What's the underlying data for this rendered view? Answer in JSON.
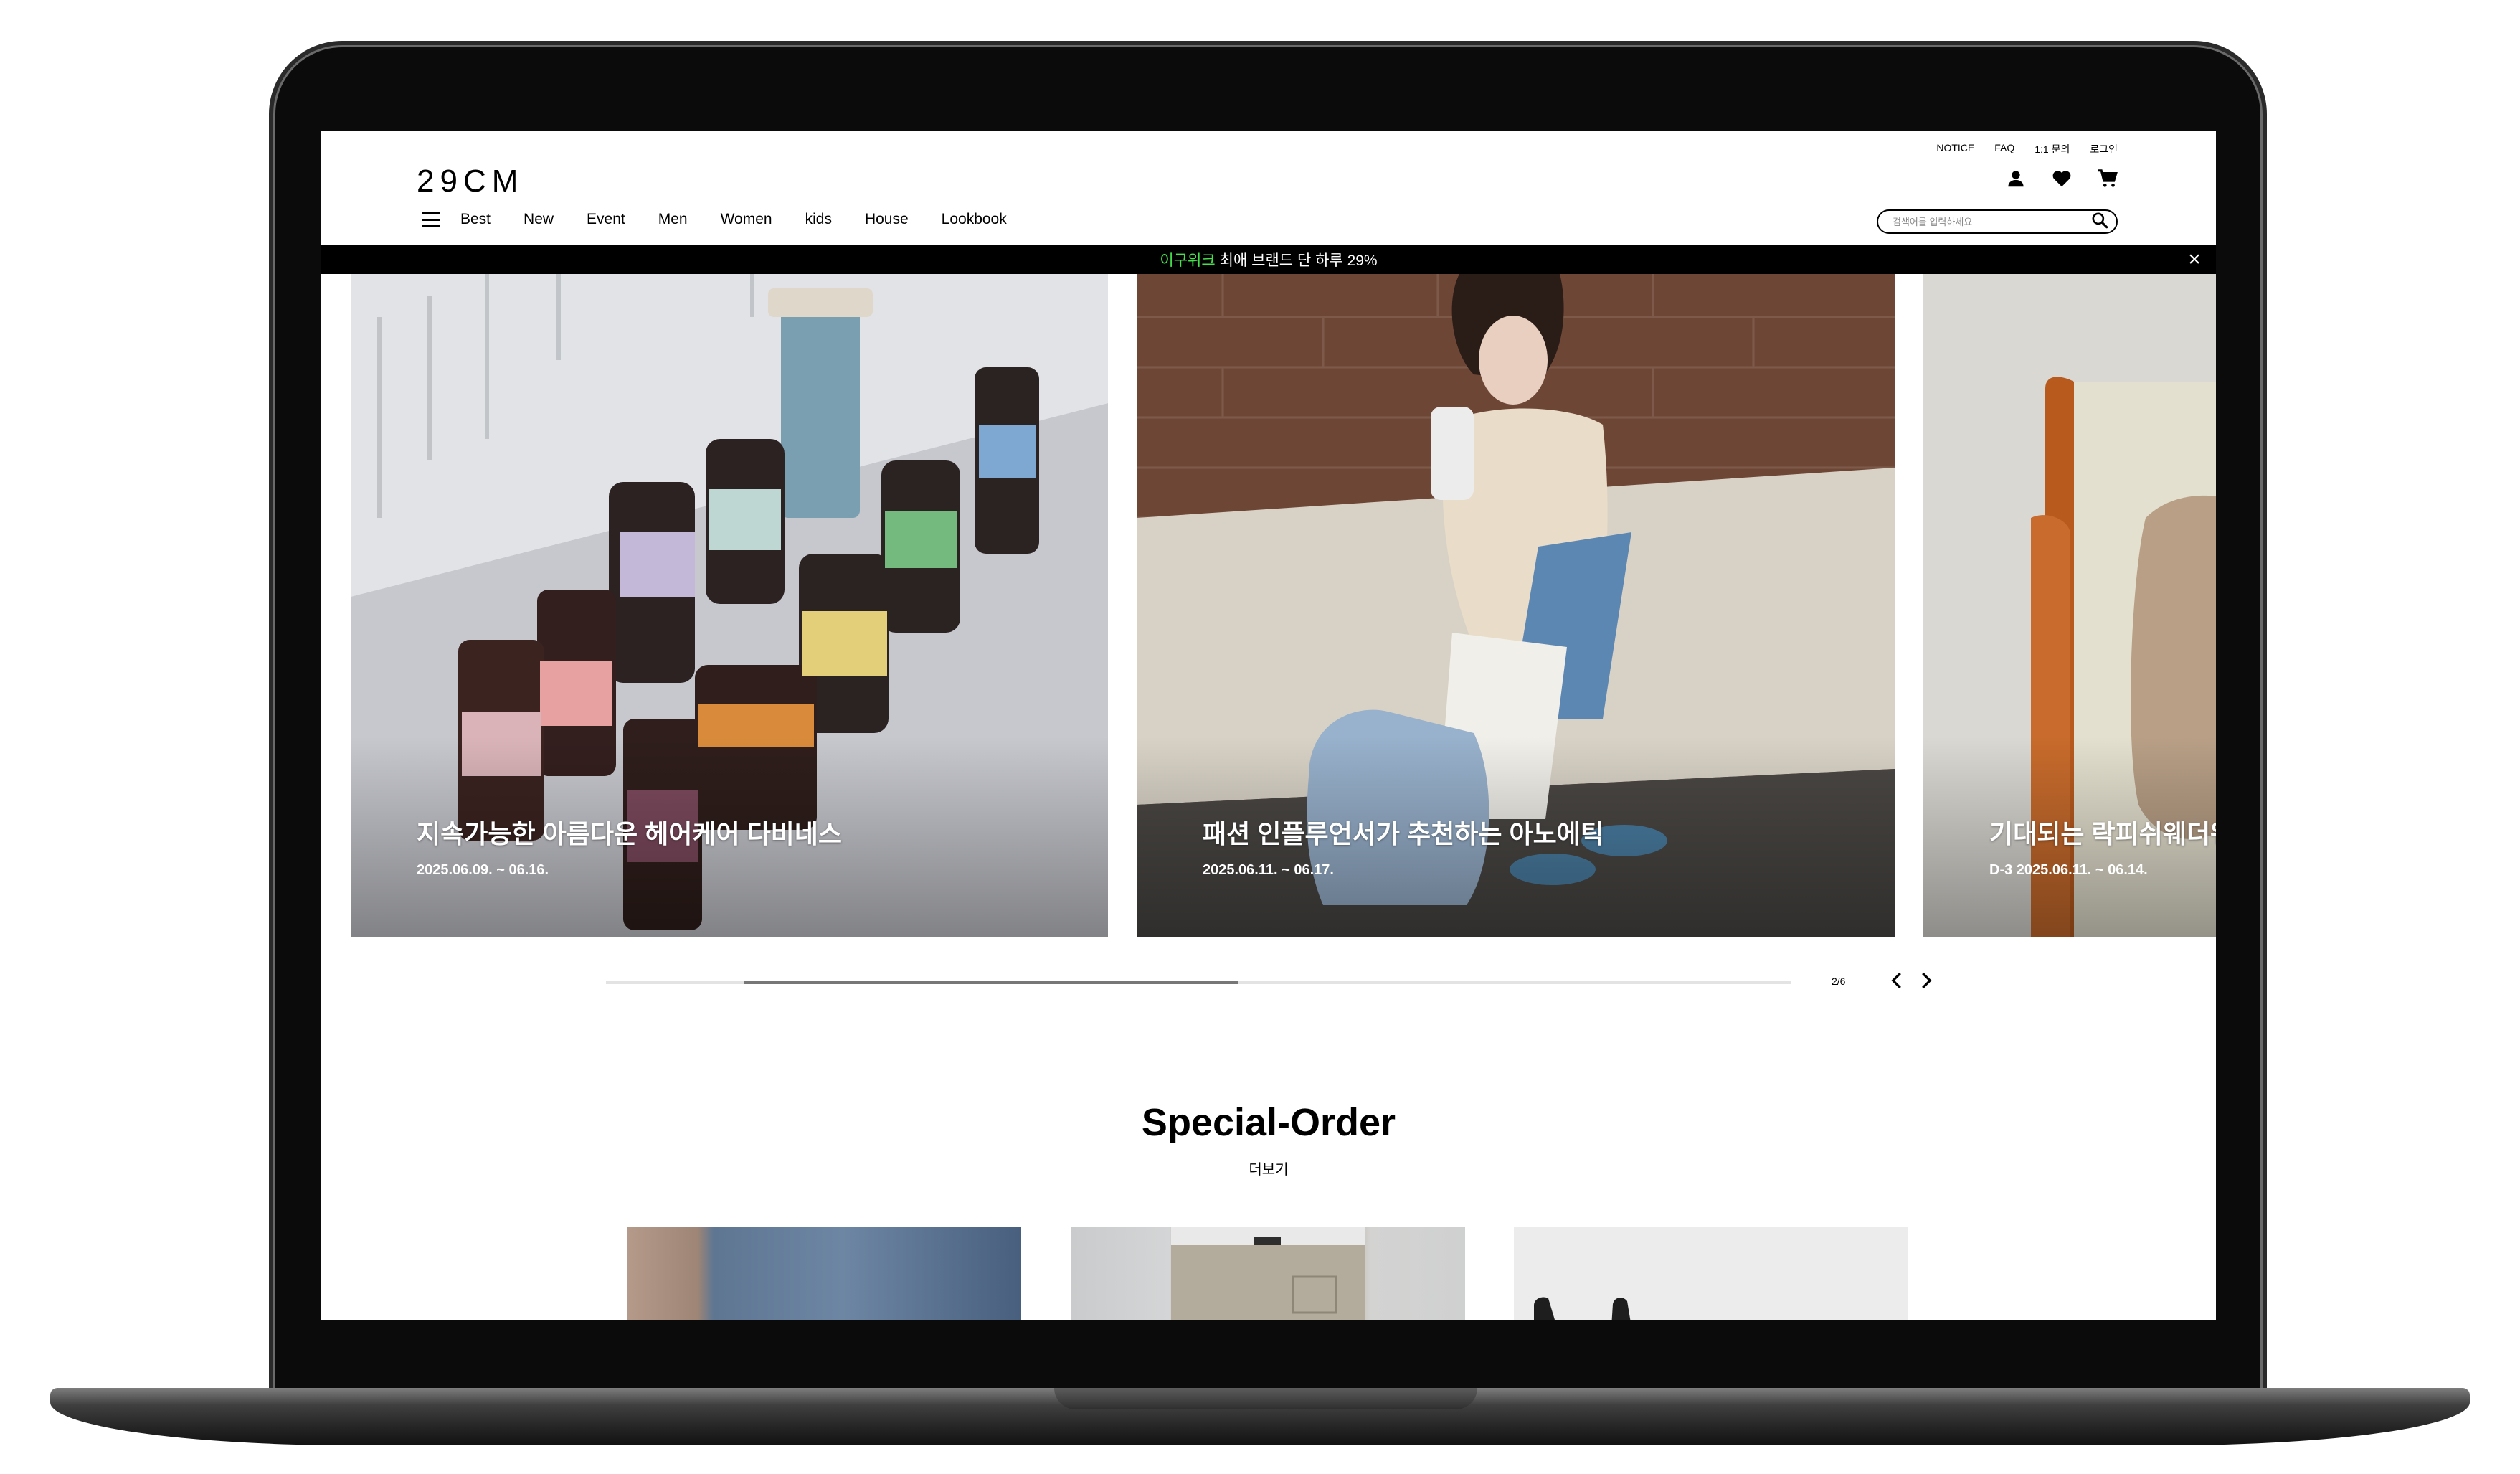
{
  "header": {
    "logo": "29CM",
    "util_links": [
      "NOTICE",
      "FAQ",
      "1:1 문의",
      "로그인"
    ],
    "icons": [
      "user-icon",
      "heart-icon",
      "cart-icon"
    ],
    "nav": [
      "Best",
      "New",
      "Event",
      "Men",
      "Women",
      "kids",
      "House",
      "Lookbook"
    ],
    "search_placeholder": "검색어를 입력하세요"
  },
  "announcement": {
    "highlight": "이구위크",
    "text": "최애 브랜드 단 하루 29%"
  },
  "carousel": {
    "slides": [
      {
        "title": "지속가능한 아름다운 헤어케어 다비네스",
        "date": "2025.06.09. ~ 06.16."
      },
      {
        "title": "패션 인플루언서가 추천하는 아노에틱",
        "date": "2025.06.11. ~ 06.17."
      },
      {
        "title": "기대되는 락피쉬웨더웨",
        "date": "D-3    2025.06.11. ~ 06.14."
      }
    ],
    "pager": "2/6",
    "progress": {
      "start": 0.117,
      "end": 0.534
    }
  },
  "special_order": {
    "title": "Special-Order",
    "more": "더보기"
  },
  "colors": {
    "accent_green": "#44e34a",
    "bar_black": "#000000"
  }
}
